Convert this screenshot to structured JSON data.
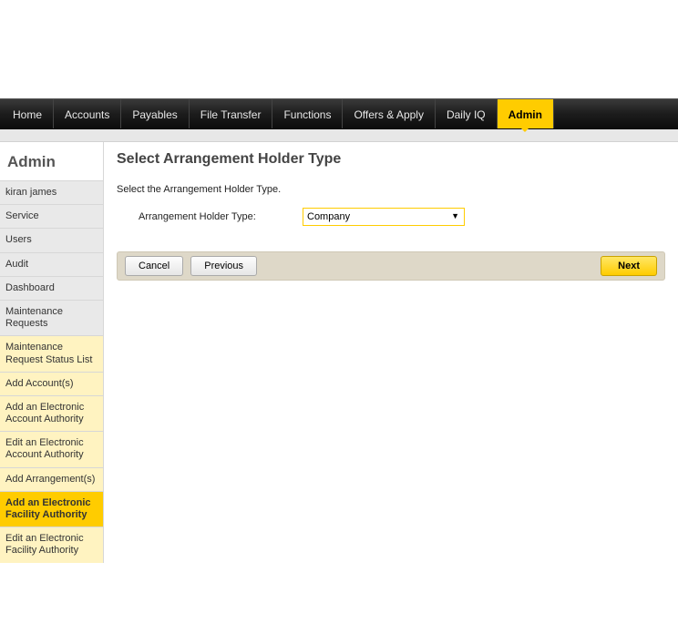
{
  "nav": {
    "items": [
      "Home",
      "Accounts",
      "Payables",
      "File Transfer",
      "Functions",
      "Offers & Apply",
      "Daily IQ",
      "Admin"
    ],
    "activeIndex": 7
  },
  "sidebar": {
    "title": "Admin",
    "items": [
      {
        "label": "kiran james",
        "tone": "grey"
      },
      {
        "label": "Service",
        "tone": "grey"
      },
      {
        "label": "Users",
        "tone": "grey"
      },
      {
        "label": "Audit",
        "tone": "grey"
      },
      {
        "label": "Dashboard",
        "tone": "grey"
      },
      {
        "label": "Maintenance Requests",
        "tone": "grey"
      },
      {
        "label": "Maintenance Request Status List",
        "tone": "light"
      },
      {
        "label": "Add Account(s)",
        "tone": "light"
      },
      {
        "label": "Add an Electronic Account Authority",
        "tone": "light"
      },
      {
        "label": "Edit an Electronic Account Authority",
        "tone": "light"
      },
      {
        "label": "Add Arrangement(s)",
        "tone": "light"
      },
      {
        "label": "Add an Electronic Facility Authority",
        "tone": "selected"
      },
      {
        "label": "Edit an Electronic Facility Authority",
        "tone": "light"
      }
    ]
  },
  "main": {
    "heading": "Select Arrangement Holder Type",
    "instruction": "Select the Arrangement Holder Type.",
    "fieldLabel": "Arrangement Holder Type:",
    "select": {
      "value": "Company",
      "options": [
        "Company"
      ]
    },
    "buttons": {
      "cancel": "Cancel",
      "previous": "Previous",
      "next": "Next"
    }
  }
}
